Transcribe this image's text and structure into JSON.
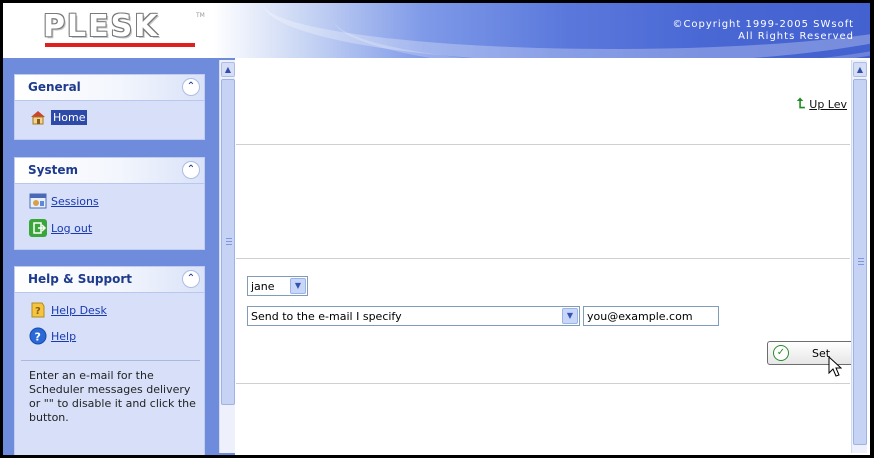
{
  "header": {
    "logo_text": "PLESK",
    "logo_tm": "TM",
    "copyright_line1": "©Copyright 1999-2005 SWsoft",
    "copyright_line2": "All Rights Reserved"
  },
  "nav": {
    "general": {
      "title": "General",
      "items": [
        {
          "label": "Home",
          "icon": "home-icon",
          "selected": true
        }
      ]
    },
    "system": {
      "title": "System",
      "items": [
        {
          "label": "Sessions",
          "icon": "sessions-icon"
        },
        {
          "label": "Log out",
          "icon": "logout-icon"
        }
      ]
    },
    "help": {
      "title": "Help & Support",
      "items": [
        {
          "label": "Help Desk",
          "icon": "helpdesk-icon"
        },
        {
          "label": "Help",
          "icon": "help-icon"
        }
      ],
      "hint": "Enter an e-mail for the Scheduler messages delivery or \"\" to disable it and click the button."
    },
    "collapse_glyph": "⌃"
  },
  "main": {
    "up_level_label": "Up Lev",
    "user_select": {
      "value": "jane"
    },
    "delivery_select": {
      "value": "Send to the e-mail I specify"
    },
    "email_field": {
      "value": "you@example.com"
    },
    "set_button_label": "Set"
  },
  "colors": {
    "nav_bg": "#6f8bdc",
    "nav_box_bg": "#d7e0f8",
    "link": "#1a3ab0",
    "header_right": "#4361cf",
    "logo_underline": "#e0201e"
  }
}
